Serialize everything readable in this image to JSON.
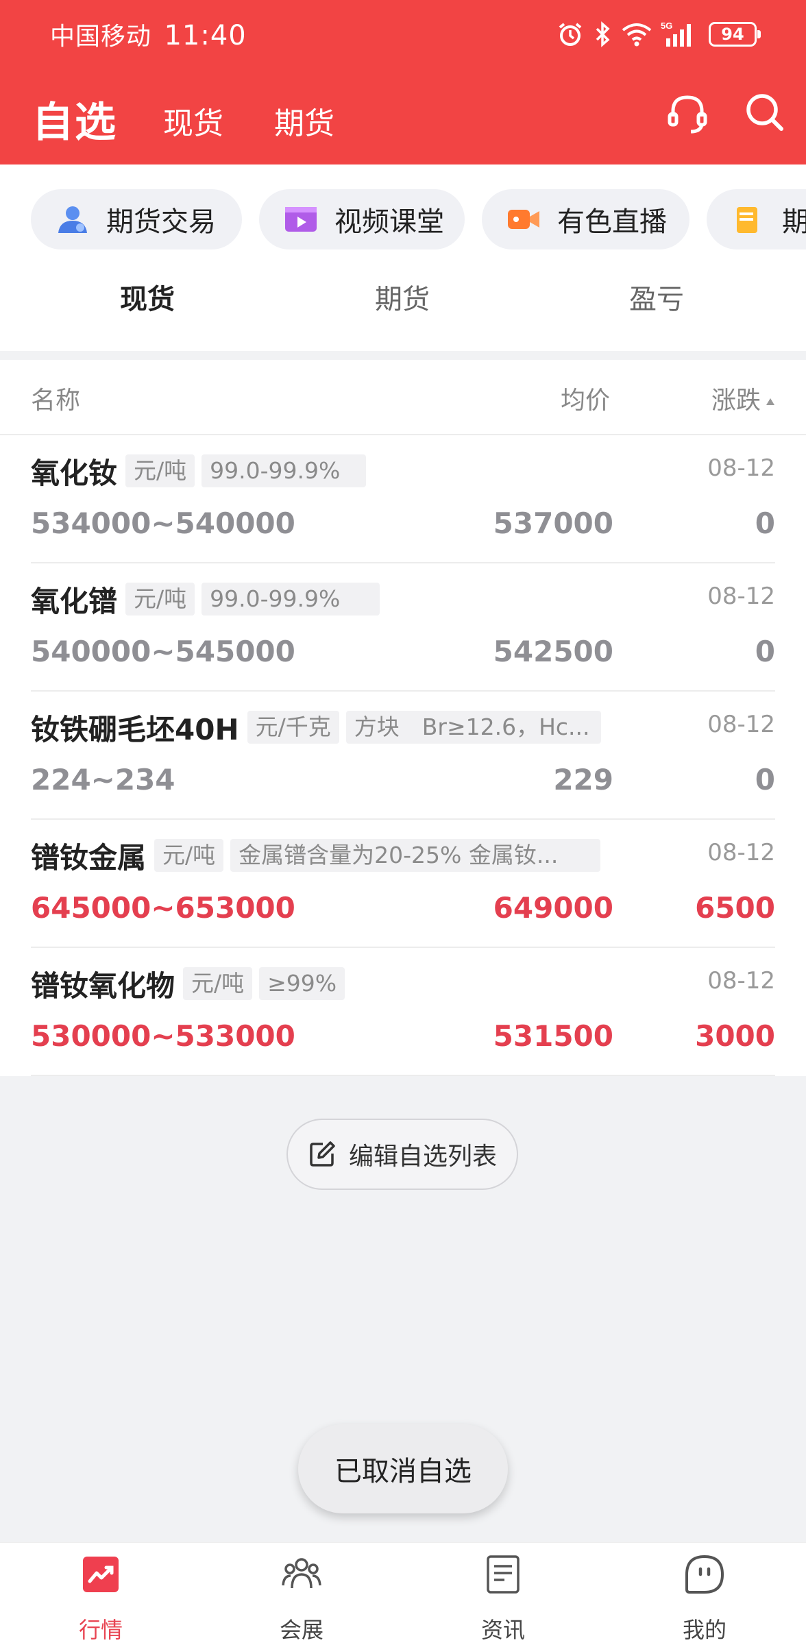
{
  "status_bar": {
    "carrier": "中国移动",
    "time": "11:40",
    "battery": "94",
    "network": "5G"
  },
  "nav": {
    "title": "自选",
    "tabs": [
      "现货",
      "期货"
    ],
    "icons": [
      "headset-icon",
      "search-icon"
    ]
  },
  "shortcuts": [
    {
      "label": "期货交易",
      "icon": "person-icon"
    },
    {
      "label": "视频课堂",
      "icon": "video-icon"
    },
    {
      "label": "有色直播",
      "icon": "camera-icon"
    },
    {
      "label": "期货",
      "icon": "book-icon"
    }
  ],
  "sub_tabs": [
    {
      "label": "现货",
      "active": true
    },
    {
      "label": "期货",
      "active": false
    },
    {
      "label": "盈亏",
      "active": false
    }
  ],
  "list": {
    "headers": {
      "name": "名称",
      "avg_price": "均价",
      "change": "涨跌"
    },
    "rows": [
      {
        "name": "氧化钕",
        "unit": "元/吨",
        "spec": "99.0-99.9%",
        "date": "08-12",
        "range": "534000~540000",
        "avg": "537000",
        "change": "0",
        "trend": "flat"
      },
      {
        "name": "氧化镨",
        "unit": "元/吨",
        "spec": "99.0-99.9%",
        "date": "08-12",
        "range": "540000~545000",
        "avg": "542500",
        "change": "0",
        "trend": "flat"
      },
      {
        "name": "钕铁硼毛坯40H",
        "unit": "元/千克",
        "spec": "方块　Br≥12.6，Hc...",
        "date": "08-12",
        "range": "224~234",
        "avg": "229",
        "change": "0",
        "trend": "flat"
      },
      {
        "name": "镨钕金属",
        "unit": "元/吨",
        "spec": "金属镨含量为20-25% 金属钕...",
        "date": "08-12",
        "range": "645000~653000",
        "avg": "649000",
        "change": "6500",
        "trend": "up"
      },
      {
        "name": "镨钕氧化物",
        "unit": "元/吨",
        "spec": "≥99%",
        "date": "08-12",
        "range": "530000~533000",
        "avg": "531500",
        "change": "3000",
        "trend": "up"
      }
    ]
  },
  "edit_button": {
    "label": "编辑自选列表"
  },
  "toast": {
    "text": "已取消自选"
  },
  "tabbar": {
    "items": [
      {
        "label": "行情",
        "icon": "chart-icon",
        "active": true
      },
      {
        "label": "会展",
        "icon": "people-icon",
        "active": false
      },
      {
        "label": "资讯",
        "icon": "news-icon",
        "active": false
      },
      {
        "label": "我的",
        "icon": "profile-icon",
        "active": false
      }
    ]
  },
  "colors": {
    "brand_red": "#f24444",
    "up_red": "#e43f4f",
    "flat_gray": "#8f8f94"
  }
}
